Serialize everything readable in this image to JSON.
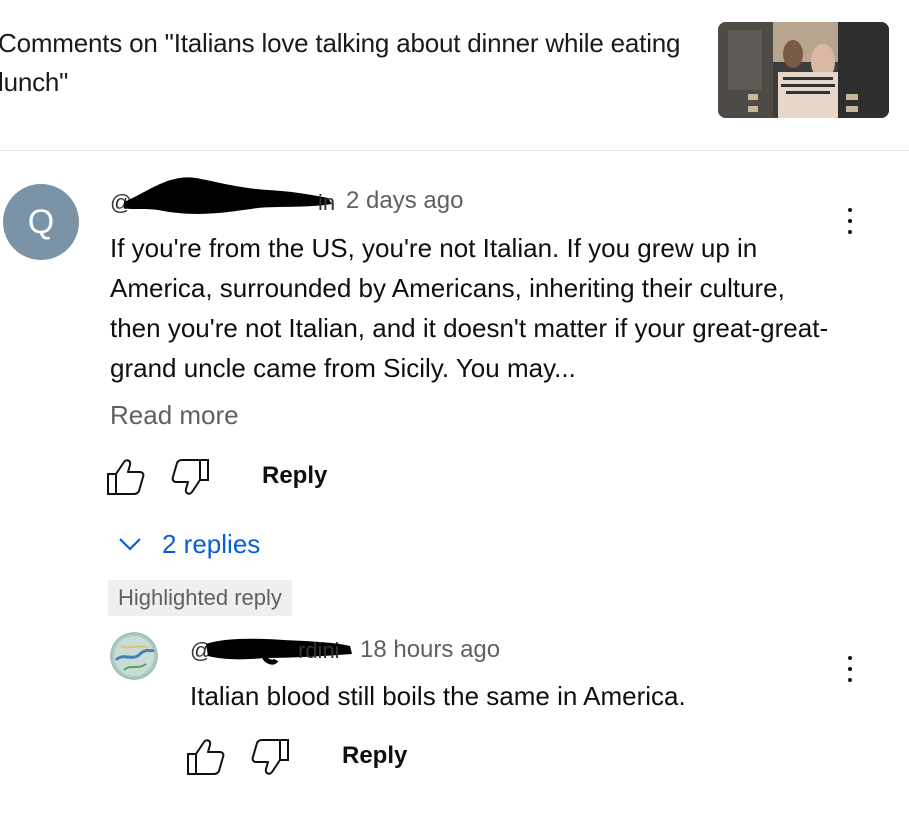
{
  "header": {
    "title": "Comments on \"Italians love talking about dinner while eating lunch\""
  },
  "comment": {
    "avatar_letter": "Q",
    "at_prefix": "@",
    "tail_chars": "in",
    "timestamp": "2 days ago",
    "body": "If you're from the US, you're not Italian. If you grew up in America, surrounded by Americans, inheriting their culture, then you're not Italian, and it doesn't matter if your great-great-grand uncle came from Sicily. You may...",
    "read_more": "Read more",
    "reply_label": "Reply",
    "replies_toggle": "2 replies"
  },
  "highlighted_badge": "Highlighted reply",
  "reply": {
    "at_prefix": "@",
    "tail_chars": "rdini",
    "timestamp": "18 hours ago",
    "body": "Italian blood still boils the same in America.",
    "reply_label": "Reply"
  },
  "colors": {
    "link_blue": "#065fd4",
    "secondary_text": "#606060",
    "avatar_bg": "#7b93a6"
  },
  "icons": [
    "thumb-up-icon",
    "thumb-down-icon",
    "more-vert-icon",
    "chevron-down-icon",
    "globe-avatar"
  ]
}
